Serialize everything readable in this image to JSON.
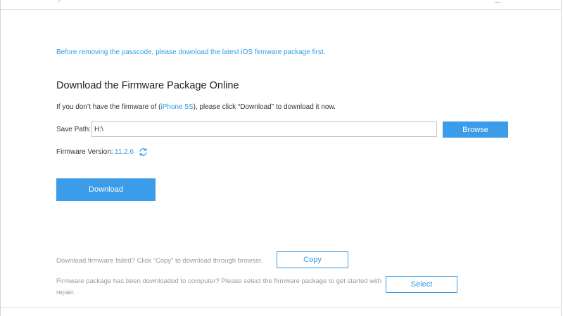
{
  "notice": "Before removing the passcode, please download the latest iOS firmware package first.",
  "section": {
    "title": "Download the Firmware Package Online",
    "instruction_pre": "If you don’t have the firmware of (",
    "device": "iPhone 5S",
    "instruction_post": "), please click “Download” to download it now."
  },
  "save_path": {
    "label": "Save Path:",
    "value": "H:\\",
    "browse_label": "Browse"
  },
  "firmware": {
    "label": "Firmware Version:",
    "version": "11.2.6"
  },
  "download_label": "Download",
  "fallback": {
    "failed_text": "Download firmware failed? Click “Copy” to download through browser.",
    "copy_label": "Copy",
    "downloaded_text": "Firmware package has been downloaded to computer? Please select the firmware package to get started with repair.",
    "select_label": "Select"
  },
  "icons": {
    "refresh": "refresh-icon"
  },
  "colors": {
    "accent": "#3b9ce9",
    "link": "#2f9be6",
    "muted_text": "#9a9a9a"
  }
}
